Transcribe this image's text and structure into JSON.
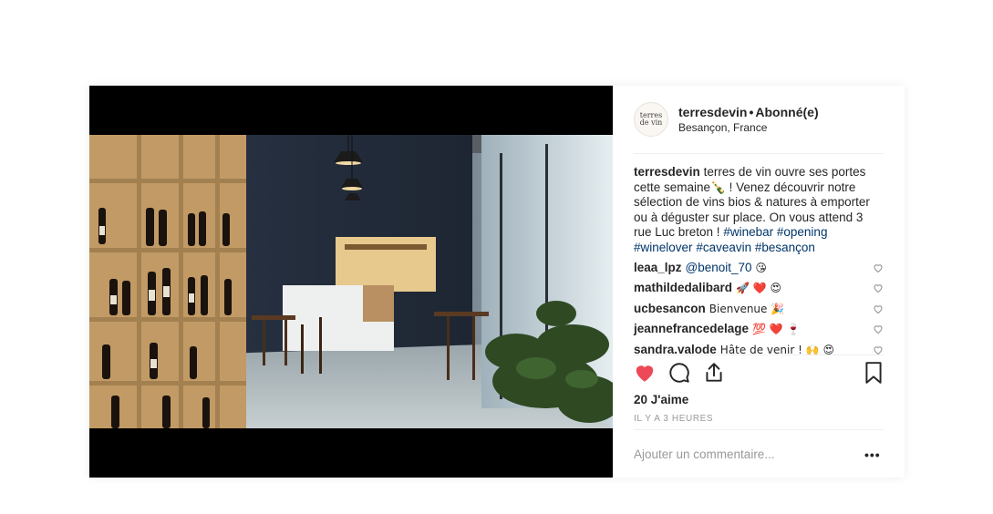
{
  "post": {
    "username": "terresdevin",
    "follow_status": "Abonné(e)",
    "location": "Besançon, France",
    "avatar_text_line1": "terres",
    "avatar_text_line2": "de vin",
    "caption_user": "terresdevin",
    "caption_text": "terres de vin ouvre ses portes cette semaine🍾 ! Venez découvrir notre sélection de vins bios & natures à emporter ou à déguster sur place. On vous attend 3 rue Luc breton !",
    "hashtags": [
      "#winebar",
      "#opening",
      "#winelover",
      "#caveavin",
      "#besançon"
    ],
    "likes": "20 J'aime",
    "timestamp": "IL Y A 3 HEURES",
    "comment_placeholder": "Ajouter un commentaire...",
    "more_label": "•••"
  },
  "comments": [
    {
      "user": "leaa_lpz",
      "text_mention": "@benoit_70",
      "text": " 😘"
    },
    {
      "user": "mathildedalibard",
      "text_mention": "",
      "text": "🚀 ❤️ 😍"
    },
    {
      "user": "ucbesancon",
      "text_mention": "",
      "text": "Bienvenue 🎉"
    },
    {
      "user": "jeannefrancedelage",
      "text_mention": "",
      "text": "💯 ❤️ 🍷"
    },
    {
      "user": "sandra.valode",
      "text_mention": "",
      "text": "Hâte de venir ! 🙌 😍"
    }
  ],
  "icons": {
    "like": "heart-filled-icon",
    "comment": "comment-bubble-icon",
    "share": "share-icon",
    "save": "bookmark-icon",
    "comment_like": "heart-outline-icon"
  },
  "colors": {
    "like_red": "#ed4956",
    "hashtag_blue": "#003569",
    "muted_gray": "#999999"
  }
}
